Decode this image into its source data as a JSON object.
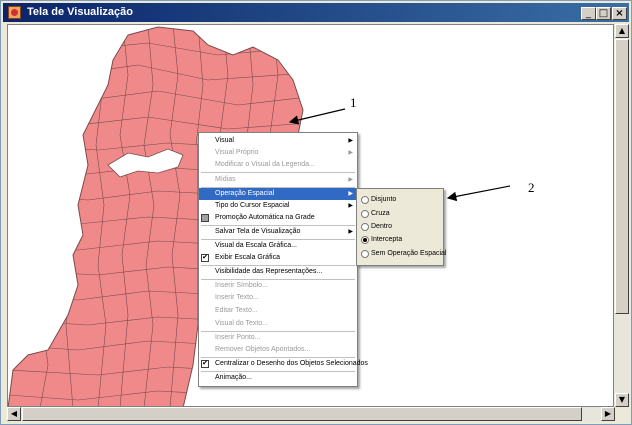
{
  "window": {
    "title": "Tela de Visualização",
    "minimize": "_",
    "maximize": "□",
    "close": "×"
  },
  "map": {
    "fill": "#f08a8a",
    "stroke": "#7a4a4a"
  },
  "context_menu": {
    "items": [
      {
        "label": "Visual",
        "enabled": true,
        "submenu": true
      },
      {
        "label": "Visual Próprio",
        "enabled": false,
        "submenu": true
      },
      {
        "label": "Modificar o Visual da Legenda...",
        "enabled": false
      },
      {
        "label": "Mídias",
        "enabled": false,
        "submenu": true
      },
      {
        "label": "Operação Espacial",
        "enabled": true,
        "submenu": true,
        "highlighted": true
      },
      {
        "label": "Tipo do Cursor Espacial",
        "enabled": true,
        "submenu": true
      },
      {
        "label": "Promoção Automática na Grade",
        "enabled": true,
        "icon": "gray-box-icon"
      },
      {
        "label": "Salvar Tela de Visualização",
        "enabled": true,
        "submenu": true
      },
      {
        "label": "Visual da Escala Gráfica...",
        "enabled": true
      },
      {
        "label": "Exibir Escala Gráfica",
        "enabled": true,
        "checked": true
      },
      {
        "label": "Visibilidade das Representações...",
        "enabled": true
      },
      {
        "label": "Inserir Símbolo...",
        "enabled": false
      },
      {
        "label": "Inserir Texto...",
        "enabled": false
      },
      {
        "label": "Editar Texto...",
        "enabled": false
      },
      {
        "label": "Visual do Texto...",
        "enabled": false
      },
      {
        "label": "Inserir Ponto...",
        "enabled": false
      },
      {
        "label": "Remover Objetos Apontados...",
        "enabled": false
      },
      {
        "label": "Centralizar o Desenho dos Objetos Selecionados",
        "enabled": true,
        "checked": true
      },
      {
        "label": "Animação...",
        "enabled": true
      }
    ]
  },
  "spatial_operation_submenu": {
    "options": [
      {
        "label": "Disjunto",
        "selected": false
      },
      {
        "label": "Cruza",
        "selected": false
      },
      {
        "label": "Dentro",
        "selected": false
      },
      {
        "label": "Intercepta",
        "selected": true
      },
      {
        "label": "Sem Operação Espacial",
        "selected": false
      }
    ]
  },
  "annotations": {
    "label_1": "1",
    "label_2": "2"
  },
  "colors": {
    "titlebar_start": "#0a246a",
    "titlebar_end": "#3a6ea5",
    "highlight": "#316ac5"
  }
}
